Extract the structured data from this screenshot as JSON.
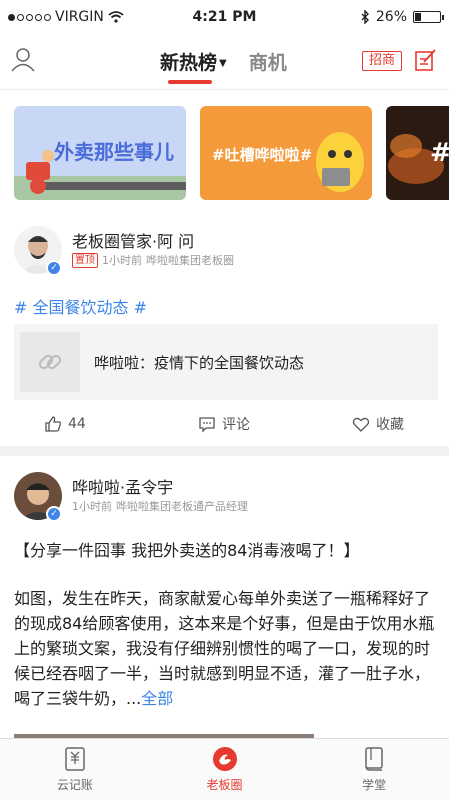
{
  "status_bar": {
    "carrier": "VIRGIN",
    "time": "4:21 PM",
    "battery": "26%",
    "battery_level": 0.26
  },
  "nav": {
    "tabs": [
      {
        "label": "新热榜",
        "active": true
      },
      {
        "label": "商机",
        "active": false
      }
    ],
    "recruit_label": "招商"
  },
  "banner": {
    "cards": [
      {
        "text": "外卖那些事儿"
      },
      {
        "text": "#吐槽哗啦啦#"
      },
      {
        "text": "#"
      }
    ]
  },
  "post1": {
    "author": "老板圈管家·阿 问",
    "pinned_label": "置顶",
    "time": "1小时前",
    "affiliation": "哗啦啦集团老板圈",
    "hashtag": "# 全国餐饮动态 #",
    "link_text": "哗啦啦：疫情下的全国餐饮动态",
    "likes": "44",
    "comment_label": "评论",
    "favorite_label": "收藏"
  },
  "post2": {
    "author": "哗啦啦·孟令宇",
    "time": "1小时前",
    "affiliation": "哗啦啦集团老板通产品经理",
    "title": "【分享一件囧事 我把外卖送的84消毒液喝了！】",
    "body": "如图，发生在昨天，商家献爱心每单外卖送了一瓶稀释好了的现成84给顾客使用，这本来是个好事，但是由于饮用水瓶上的繁琐文案，我没有仔细辨别惯性的喝了一口，发现的时候已经吞咽了一半，当时就感到明显不适，灌了一肚子水，喝了三袋牛奶，...",
    "more": "全部"
  },
  "tab_bar": {
    "items": [
      {
        "label": "云记账",
        "active": false
      },
      {
        "label": "老板圈",
        "active": true
      },
      {
        "label": "学堂",
        "active": false
      }
    ]
  },
  "colors": {
    "accent": "#e63a30",
    "link": "#3d86e8"
  }
}
